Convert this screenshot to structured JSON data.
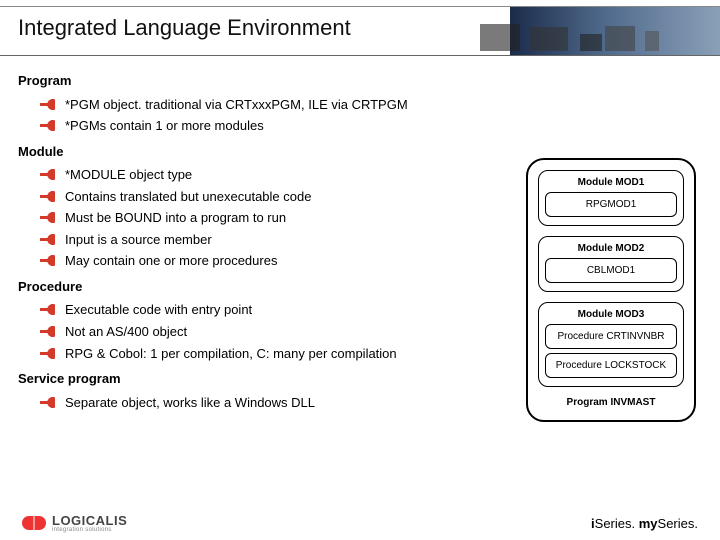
{
  "title": "Integrated Language Environment",
  "sections": {
    "program": {
      "head": "Program",
      "items": [
        "*PGM object. traditional via CRTxxxPGM, ILE via CRTPGM",
        "*PGMs contain 1 or more modules"
      ]
    },
    "module": {
      "head": "Module",
      "items": [
        "*MODULE object type",
        "Contains translated but unexecutable code",
        "Must be BOUND into a program to run",
        "Input is a source member",
        "May contain one or more procedures"
      ]
    },
    "procedure": {
      "head": "Procedure",
      "items": [
        "Executable code with entry point",
        "Not an AS/400 object",
        "RPG & Cobol: 1 per compilation, C: many per compilation"
      ]
    },
    "service": {
      "head": "Service program",
      "items": [
        "Separate object, works like a Windows DLL"
      ]
    }
  },
  "diagram": {
    "package": "Program INVMAST",
    "modules": [
      {
        "title": "Module MOD1",
        "boxes": [
          "RPGMOD1"
        ]
      },
      {
        "title": "Module MOD2",
        "boxes": [
          "CBLMOD1"
        ]
      },
      {
        "title": "Module MOD3",
        "boxes": [
          "Procedure CRTINVNBR",
          "Procedure LOCKSTOCK"
        ]
      }
    ]
  },
  "footer": {
    "logo_main": "LOGICALIS",
    "logo_sub": "integration solutions",
    "tag_i": "i",
    "tag_series1": "Series.",
    "tag_my": " my",
    "tag_series2": "Series."
  }
}
